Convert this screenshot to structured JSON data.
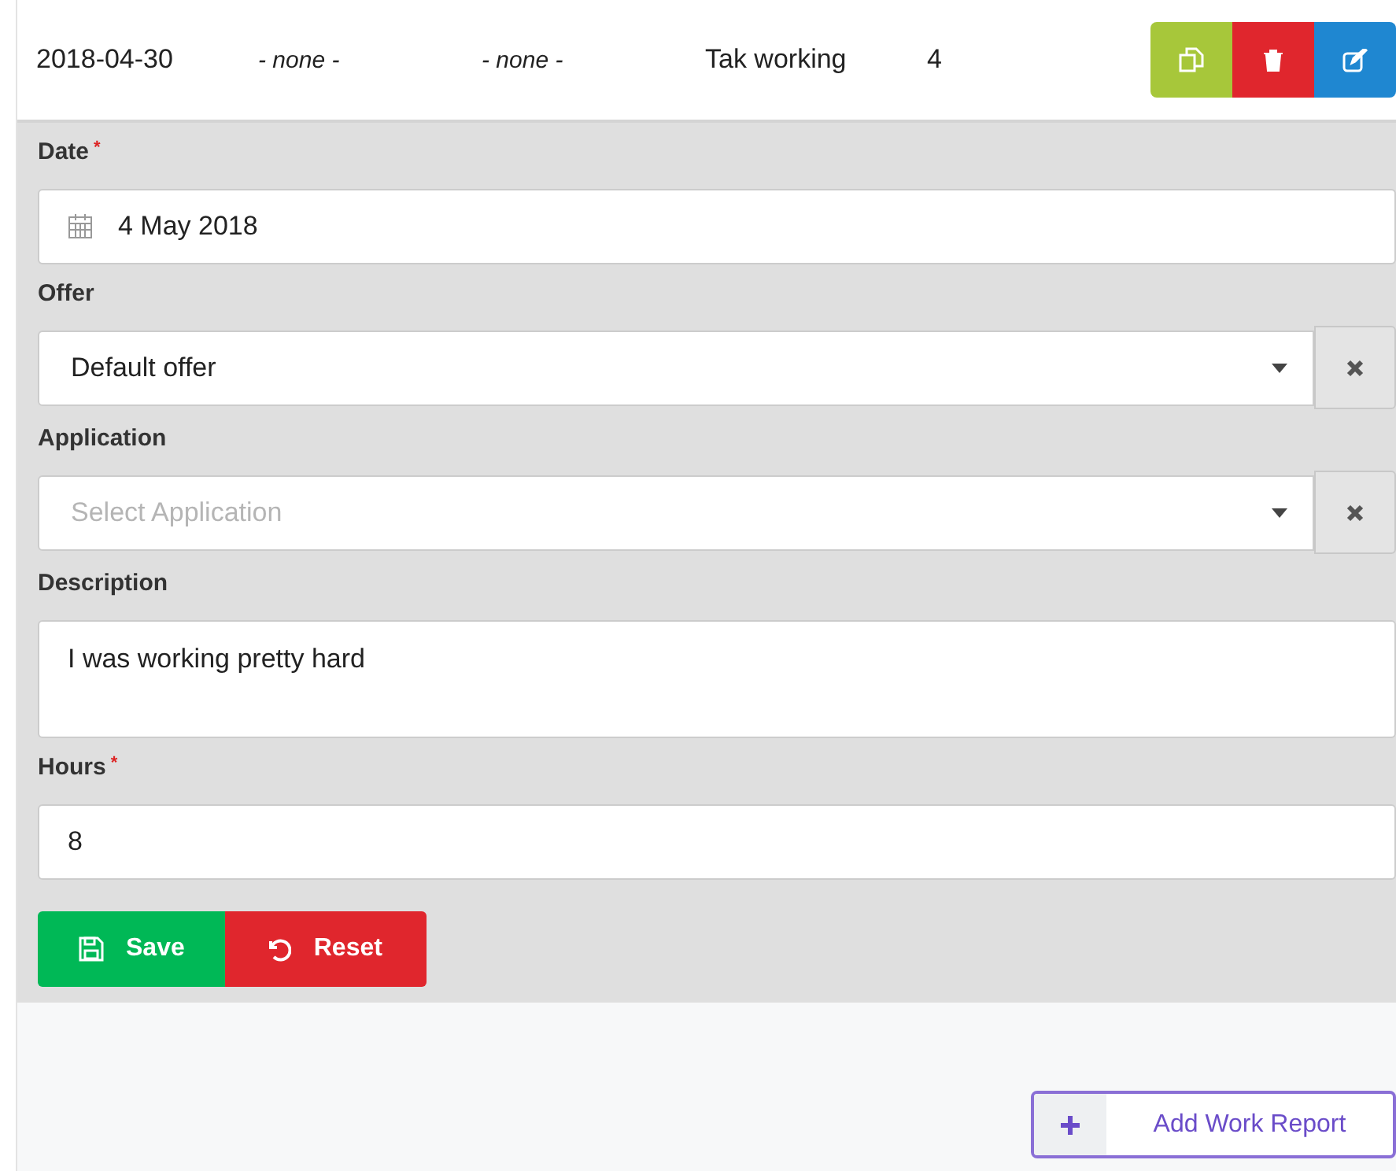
{
  "report_row": {
    "cells": [
      {
        "text": "2018-04-30",
        "italic": false
      },
      {
        "text": "- none -",
        "italic": true
      },
      {
        "text": "- none -",
        "italic": true
      },
      {
        "text": "Tak working",
        "italic": false
      },
      {
        "text": "4",
        "italic": false
      }
    ],
    "actions": [
      {
        "kind": "copy"
      },
      {
        "kind": "delete"
      },
      {
        "kind": "edit"
      }
    ]
  },
  "form": {
    "fields": [
      {
        "kind": "date",
        "label": "Date",
        "required_mark": "*",
        "value": "4 May 2018"
      },
      {
        "kind": "select",
        "label": "Offer",
        "value": "Default offer"
      },
      {
        "kind": "select",
        "label": "Application",
        "placeholder": "Select Application"
      },
      {
        "kind": "textarea",
        "label": "Description",
        "value": "I was working pretty hard"
      },
      {
        "kind": "text",
        "label": "Hours",
        "required_mark": "*",
        "value": "8"
      }
    ],
    "buttons": [
      {
        "kind": "save",
        "label": "Save"
      },
      {
        "kind": "reset",
        "label": "Reset"
      }
    ]
  },
  "add_button": {
    "label": "Add Work Report"
  }
}
